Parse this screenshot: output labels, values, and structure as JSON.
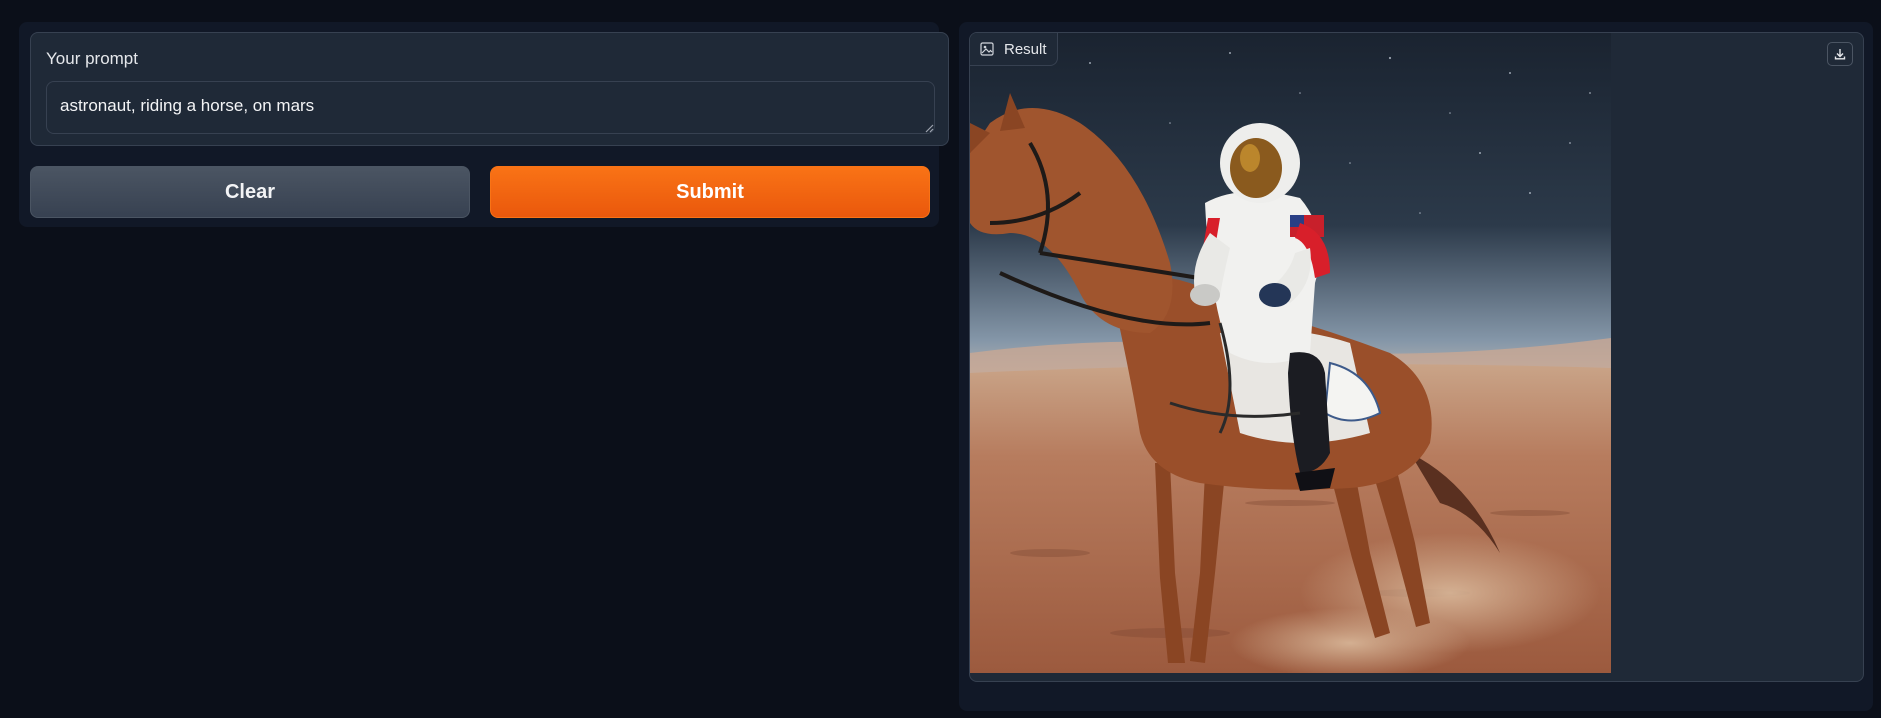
{
  "prompt": {
    "label": "Your prompt",
    "value": "astronaut, riding a horse, on mars"
  },
  "buttons": {
    "clear_label": "Clear",
    "submit_label": "Submit"
  },
  "result": {
    "label": "Result",
    "icon": "image-icon",
    "download_icon": "download-icon",
    "image_subject": "astronaut riding a horse on mars"
  },
  "colors": {
    "background": "#0b0f19",
    "panel": "#111827",
    "block": "#1f2937",
    "accent": "#f97316",
    "secondary_button": "#4b5563"
  }
}
